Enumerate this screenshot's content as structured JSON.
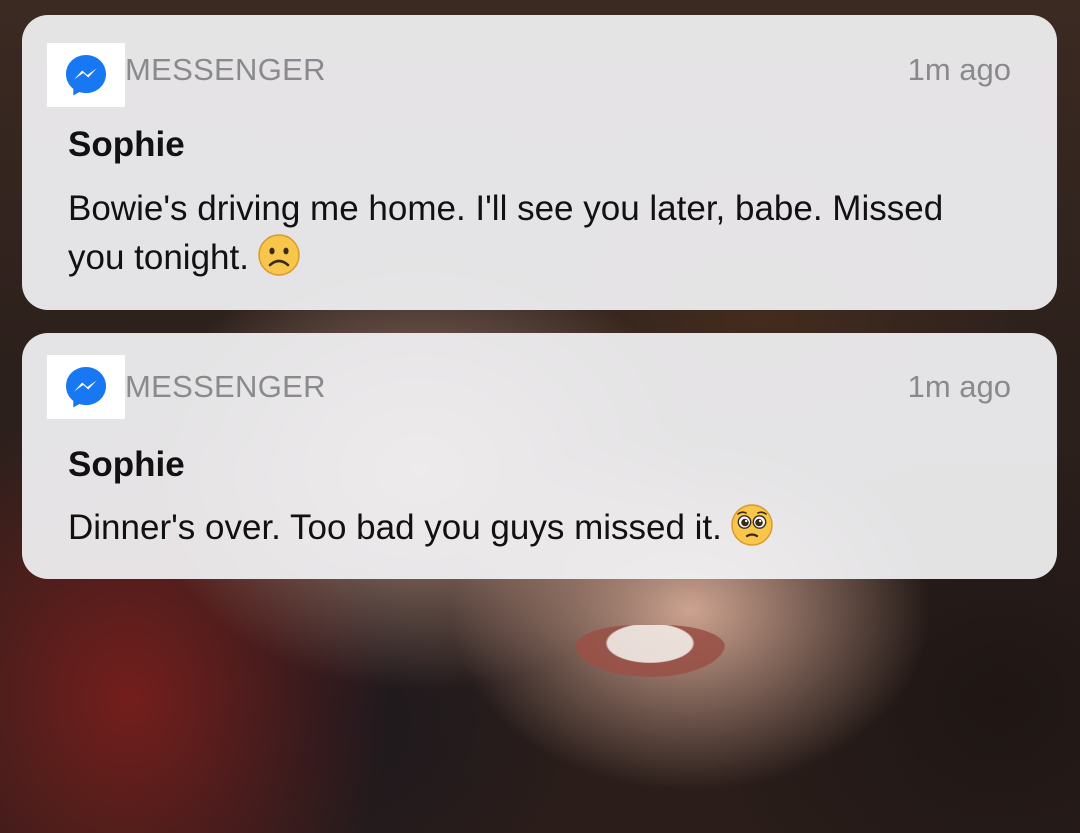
{
  "wallpaper": {
    "description_color": "#2c201c"
  },
  "notifications": [
    {
      "app_name": "MESSENGER",
      "time": "1m ago",
      "sender": "Sophie",
      "message": "Bowie's driving me home. I'll see you later, babe. Missed you tonight.",
      "emoji_icon": "frowning-face-icon"
    },
    {
      "app_name": "MESSENGER",
      "time": "1m ago",
      "sender": "Sophie",
      "message": "Dinner's over. Too bad you guys missed it.",
      "emoji_icon": "pleading-face-icon"
    }
  ],
  "colors": {
    "messenger_blue": "#1877f2",
    "card_background": "#f2f2f4",
    "secondary_text": "#8a8a8e",
    "primary_text": "#111111",
    "emoji_yellow": "#f7c64b"
  }
}
